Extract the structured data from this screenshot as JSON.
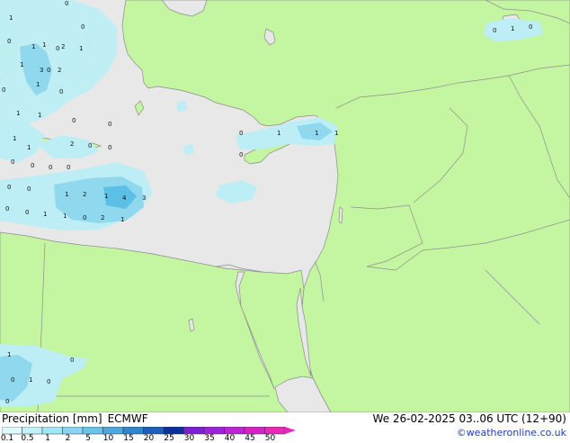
{
  "map": {
    "colors": {
      "sea": "#e8e8e8",
      "land": "#c4f5a0",
      "border": "#909090",
      "precip_light": "#bdeef6",
      "precip_mid": "#8fd8ee",
      "precip_heavy": "#5cc0e6"
    },
    "point_values": [
      "0",
      "1",
      "0",
      "1",
      "1",
      "0",
      "1",
      "0",
      "2",
      "1",
      "3",
      "2",
      "0",
      "1",
      "0",
      "1",
      "1",
      "0",
      "1",
      "0",
      "2",
      "0",
      "0",
      "0",
      "1",
      "0",
      "0",
      "0",
      "0",
      "0",
      "0",
      "1",
      "2",
      "1",
      "4",
      "3",
      "0",
      "0",
      "1",
      "1",
      "0",
      "2",
      "1",
      "0",
      "1",
      "0",
      "1",
      "1",
      "0",
      "1",
      "0",
      "1",
      "0",
      "0",
      "1",
      "0",
      "0"
    ]
  },
  "footer": {
    "title": "Precipitation [mm]",
    "model": "ECMWF",
    "datetime": "We 26-02-2025 03..06 UTC (12+90)",
    "credit": "©weatheronline.co.uk"
  },
  "legend": {
    "labels": [
      "0.1",
      "0.5",
      "1",
      "2",
      "5",
      "10",
      "15",
      "20",
      "25",
      "30",
      "35",
      "40",
      "45",
      "50"
    ],
    "colors": [
      "#e0fafc",
      "#c1f2fa",
      "#a4e6f6",
      "#86d6f1",
      "#67c5ea",
      "#4aa9e0",
      "#2c86d2",
      "#1a5fc0",
      "#0b2fa0",
      "#7a20d8",
      "#a020e0",
      "#c020d8",
      "#d820c8",
      "#e828b8"
    ]
  }
}
